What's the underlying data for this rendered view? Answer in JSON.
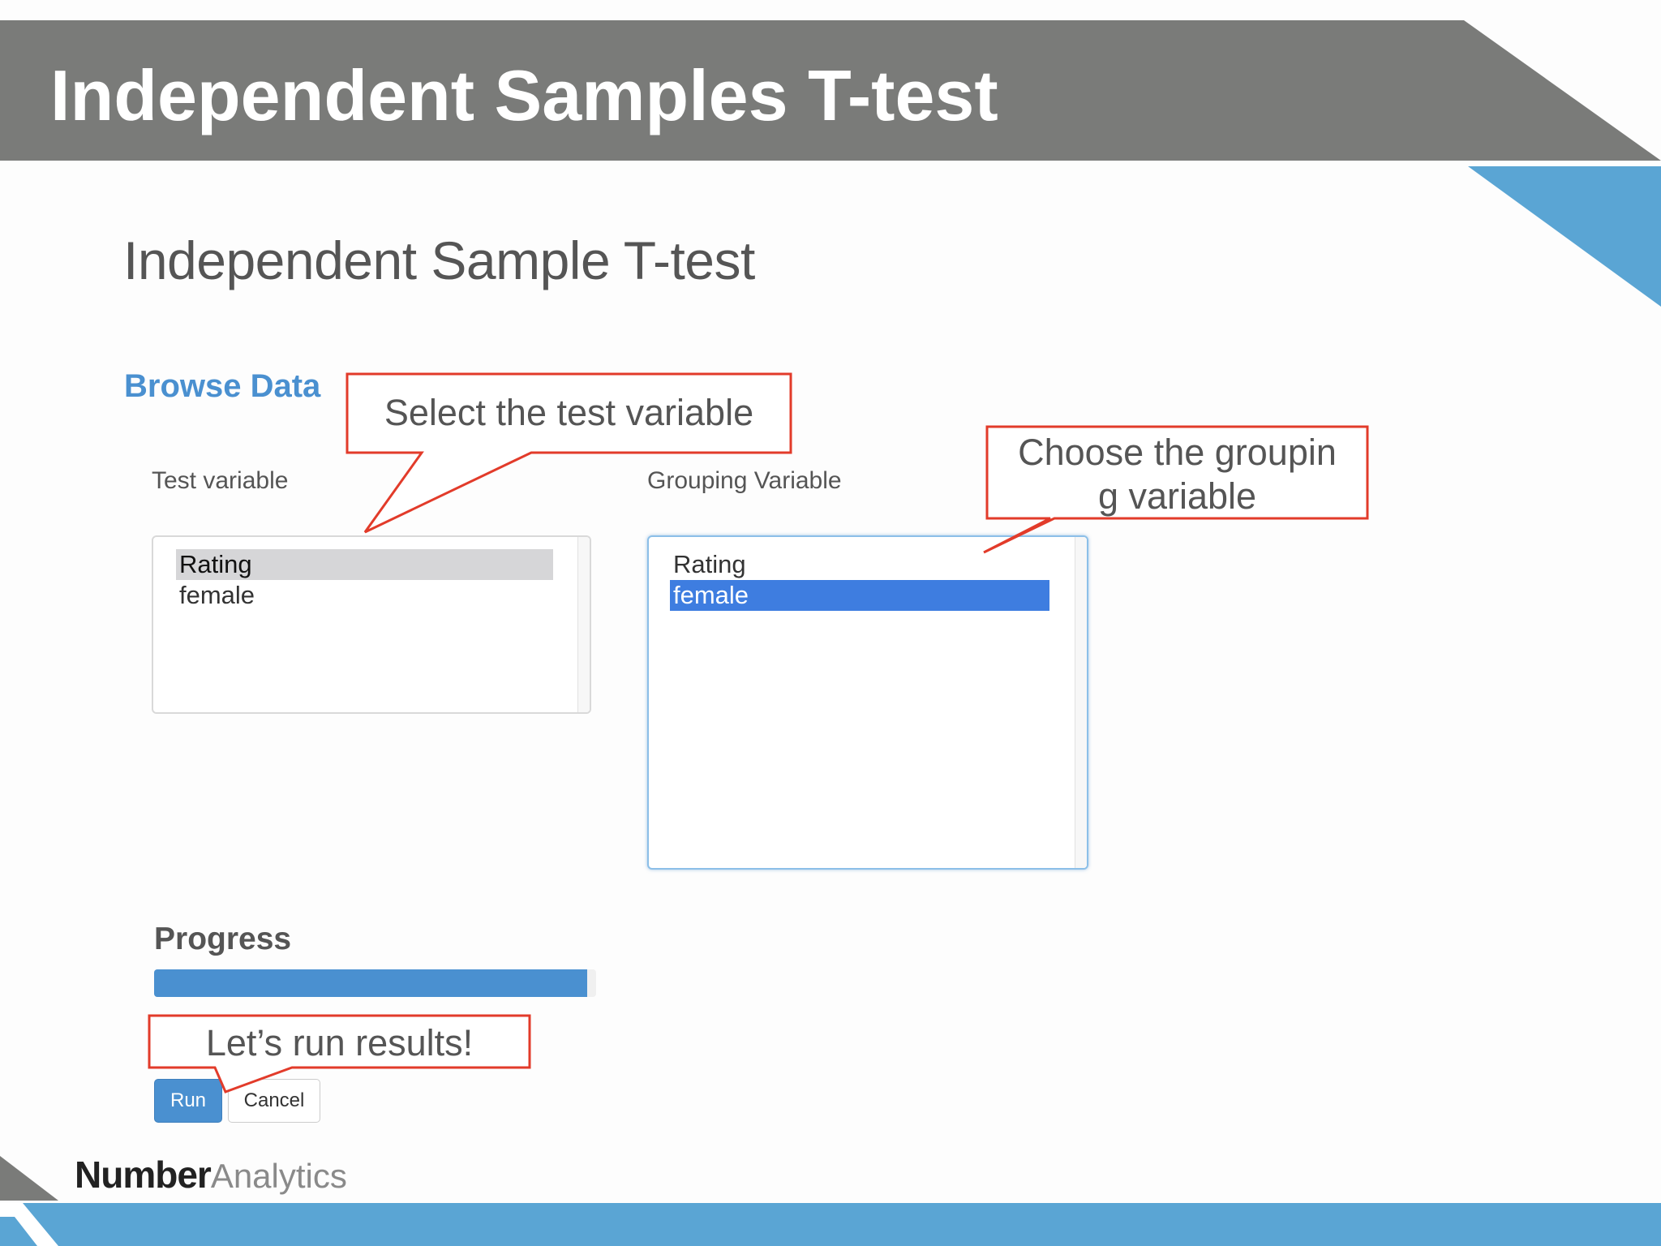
{
  "slide": {
    "title": "Independent Samples T-test",
    "colors": {
      "header_band": "#7a7b79",
      "accent_blue": "#5aa5d4"
    }
  },
  "app": {
    "title": "Independent Sample T-test",
    "browse_link": "Browse Data",
    "test_variable": {
      "label": "Test variable",
      "options": [
        "Rating",
        "female"
      ],
      "selected": "Rating"
    },
    "grouping_variable": {
      "label": "Grouping Variable",
      "options": [
        "Rating",
        "female"
      ],
      "selected": "female"
    },
    "progress": {
      "label": "Progress",
      "value_percent": 98
    },
    "buttons": {
      "run": "Run",
      "cancel": "Cancel"
    }
  },
  "annotations": {
    "select_test": "Select the test variable",
    "choose_grouping_line1": "Choose the groupin",
    "choose_grouping_line2": "g variable",
    "run_results": "Let’s run results!",
    "callout_color": "#e23b2a"
  },
  "logo": {
    "part1": "Number",
    "part2": "Analytics"
  }
}
